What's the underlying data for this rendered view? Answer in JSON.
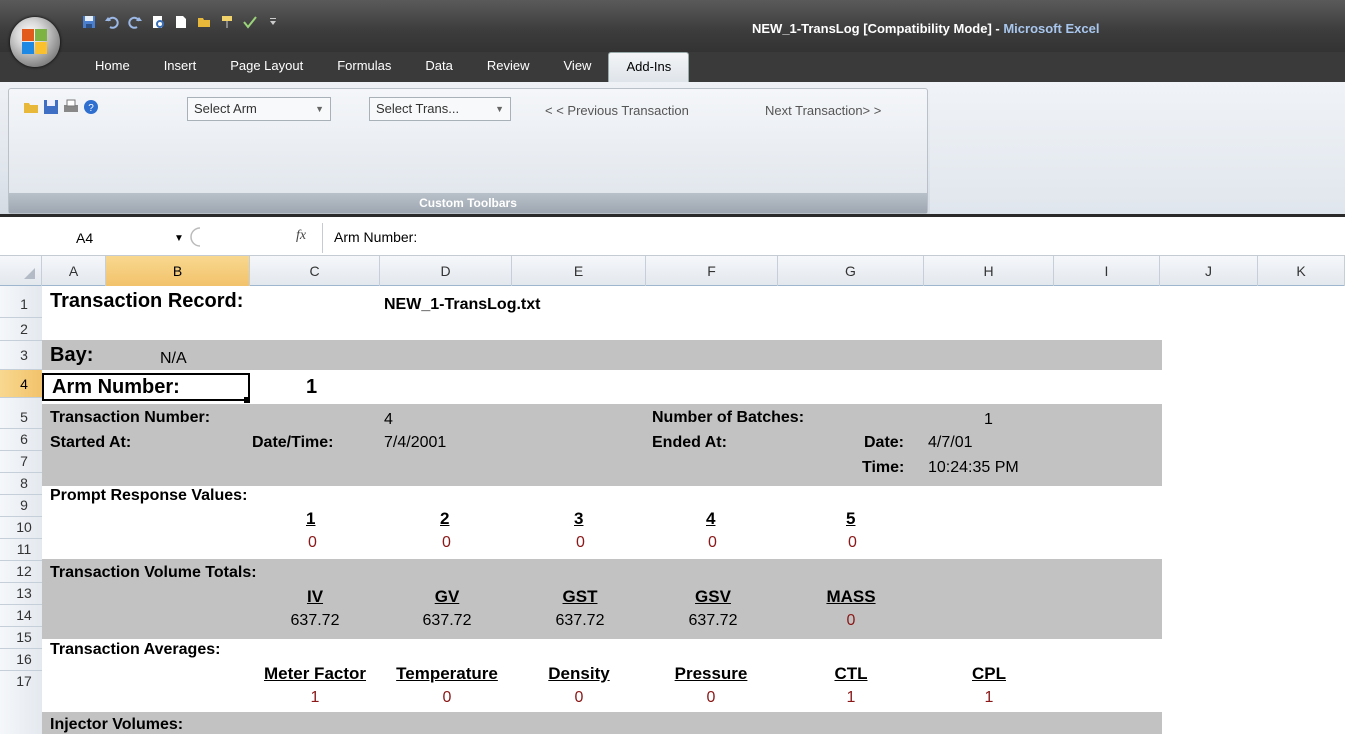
{
  "window": {
    "title_doc": "NEW_1-TransLog  [Compatibility Mode]  - ",
    "title_app": "Microsoft Excel"
  },
  "qat": {
    "icons": [
      "save-icon",
      "undo-icon",
      "redo-icon",
      "print-preview-icon",
      "new-icon",
      "open-icon",
      "format-painter-icon",
      "spellcheck-icon",
      "customize-icon"
    ]
  },
  "tabs": [
    "Home",
    "Insert",
    "Page Layout",
    "Formulas",
    "Data",
    "Review",
    "View",
    "Add-Ins"
  ],
  "ribbon": {
    "select_arm": "Select Arm",
    "select_trans": "Select Trans...",
    "prev": "< < Previous Transaction",
    "next": "Next Transaction> >",
    "group_label": "Custom Toolbars"
  },
  "formula_bar": {
    "name_box": "A4",
    "fx": "fx",
    "formula": "Arm Number:"
  },
  "columns": [
    "A",
    "B",
    "C",
    "D",
    "E",
    "F",
    "G",
    "H",
    "I",
    "J",
    "K"
  ],
  "rows": [
    "1",
    "2",
    "3",
    "4",
    "5",
    "6",
    "7",
    "8",
    "9",
    "10",
    "11",
    "12",
    "13",
    "14",
    "15",
    "16",
    "17"
  ],
  "sheet": {
    "r1": {
      "title": "Transaction Record:",
      "file": "NEW_1-TransLog.txt"
    },
    "r3": {
      "label": "Bay:",
      "value": "N/A"
    },
    "r4": {
      "label": "Arm Number:",
      "value": "1"
    },
    "r5": {
      "tn_label": "Transaction Number:",
      "tn_value": "4",
      "nb_label": "Number of Batches:",
      "nb_value": "1"
    },
    "r6": {
      "started": "Started At:",
      "dt_label": "Date/Time:",
      "dt_value": "7/4/2001",
      "ended": "Ended At:",
      "date_label": "Date:",
      "date_value": "4/7/01"
    },
    "r7": {
      "time_label": "Time:",
      "time_value": "10:24:35 PM"
    },
    "r8": {
      "label": "Prompt Response Values:"
    },
    "prompt": {
      "headers": [
        "1",
        "2",
        "3",
        "4",
        "5"
      ],
      "values": [
        "0",
        "0",
        "0",
        "0",
        "0"
      ]
    },
    "r11": {
      "label": "Transaction Volume Totals:"
    },
    "volume": {
      "headers": [
        "IV",
        "GV",
        "GST",
        "GSV",
        "MASS"
      ],
      "values": [
        "637.72",
        "637.72",
        "637.72",
        "637.72",
        "0"
      ]
    },
    "r14": {
      "label": "Transaction Averages:"
    },
    "averages": {
      "headers": [
        "Meter Factor",
        "Temperature",
        "Density",
        "Pressure",
        "CTL",
        "CPL"
      ],
      "values": [
        "1",
        "0",
        "0",
        "0",
        "1",
        "1"
      ]
    },
    "r17": {
      "label": "Injector Volumes:"
    }
  },
  "colors": {
    "band": "#c2c2c2",
    "selected_header": "#f2c26b",
    "red_value": "#8a1818"
  }
}
